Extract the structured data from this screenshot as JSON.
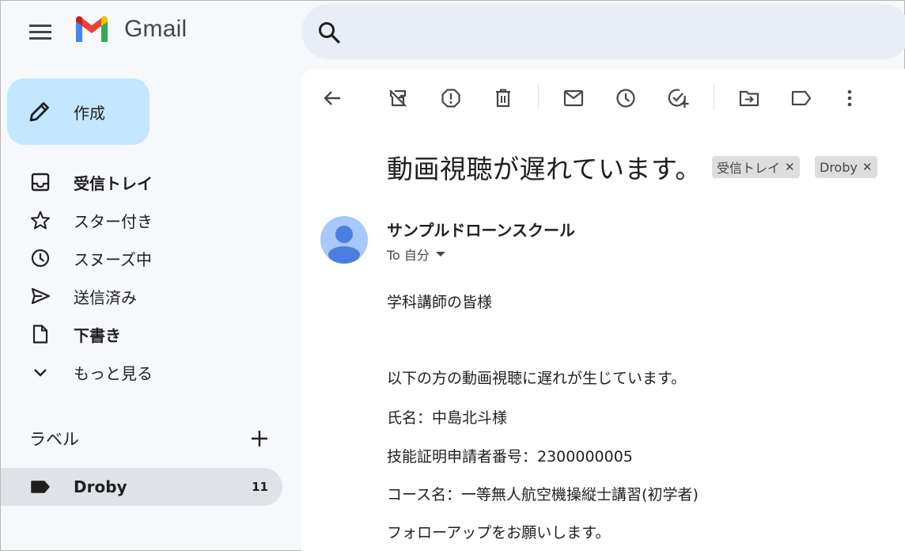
{
  "app": {
    "name": "Gmail"
  },
  "search": {
    "placeholder": ""
  },
  "compose": {
    "label": "作成"
  },
  "nav": {
    "inbox": "受信トレイ",
    "starred": "スター付き",
    "snoozed": "スヌーズ中",
    "sent": "送信済み",
    "drafts": "下書き",
    "more": "もっと見る"
  },
  "labels": {
    "heading": "ラベル",
    "items": [
      {
        "name": "Droby",
        "count": "11"
      }
    ]
  },
  "toolbar": {
    "icons": [
      "back-arrow-icon",
      "archive-icon",
      "report-spam-icon",
      "delete-icon",
      "mark-unread-icon",
      "snooze-icon",
      "add-to-tasks-icon",
      "move-to-icon",
      "label-icon",
      "more-vert-icon"
    ]
  },
  "email": {
    "subject": "動画視聴が遅れています。",
    "chips": [
      "受信トレイ",
      "Droby"
    ],
    "sender": "サンプルドローンスクール",
    "recipient": "To 自分",
    "body": [
      "学科講師の皆様",
      "以下の方の動画視聴に遅れが生じています。",
      "氏名：中島北斗様",
      "技能証明申請者番号：2300000005",
      "コース名：一等無人航空機操縦士講習(初学者)",
      "フォローアップをお願いします。"
    ]
  },
  "colors": {
    "background": "#f6f8fc",
    "compose": "#c2e7ff",
    "search": "#e9eef6",
    "selected_label": "#dfe3e7",
    "avatar": "#a8c7fa",
    "avatar_figure": "#4a7ee0"
  }
}
